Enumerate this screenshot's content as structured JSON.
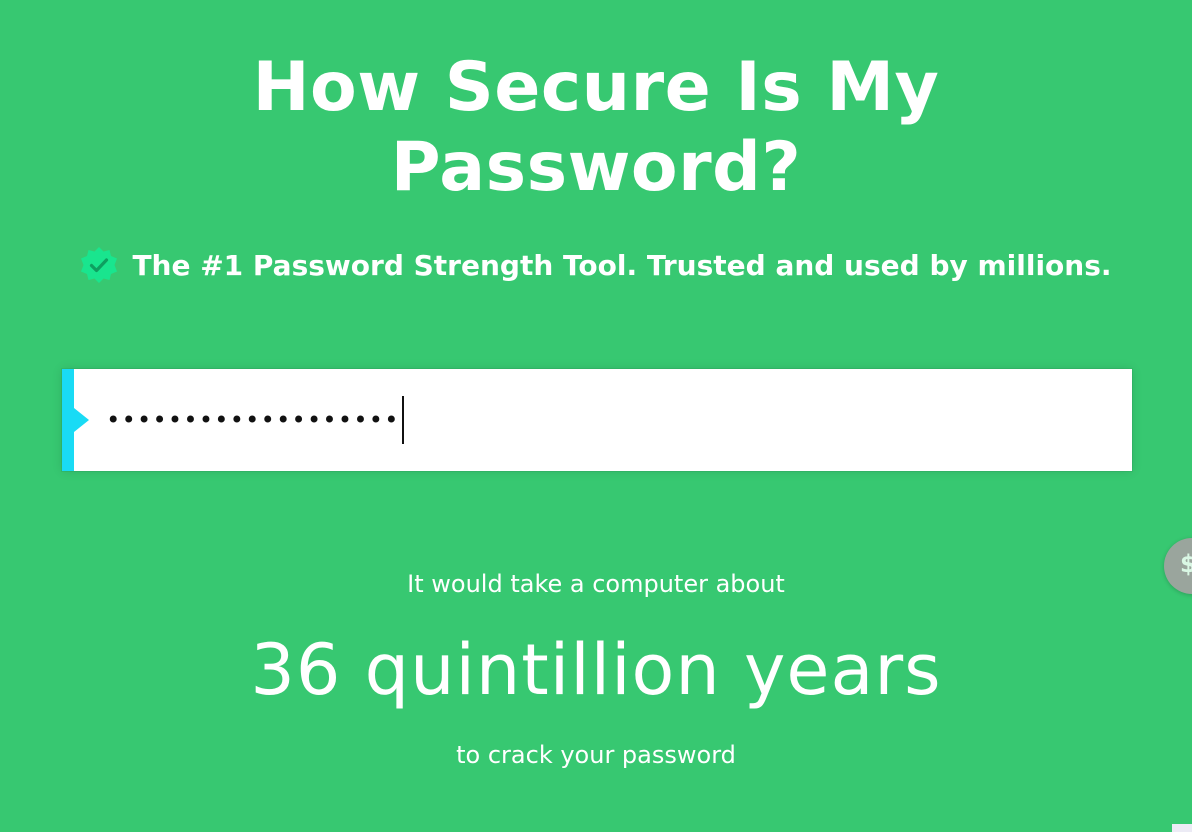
{
  "header": {
    "title_line1": "How Secure Is My",
    "title_line2": "Password?",
    "tagline": "The #1 Password Strength Tool. Trusted and used by millions.",
    "tagline_icon": "verified-badge-icon"
  },
  "password_field": {
    "masked_value": "•••••••••••••••••••",
    "strength_color": "#19dbf5"
  },
  "result": {
    "prefix": "It would take a computer about",
    "time": "36 quintillion years",
    "suffix": "to crack your password"
  },
  "side_widget": {
    "icon": "dollar-icon",
    "glyph": "$"
  },
  "colors": {
    "background": "#37c871",
    "badge": "#19e58e",
    "text": "#ffffff"
  }
}
